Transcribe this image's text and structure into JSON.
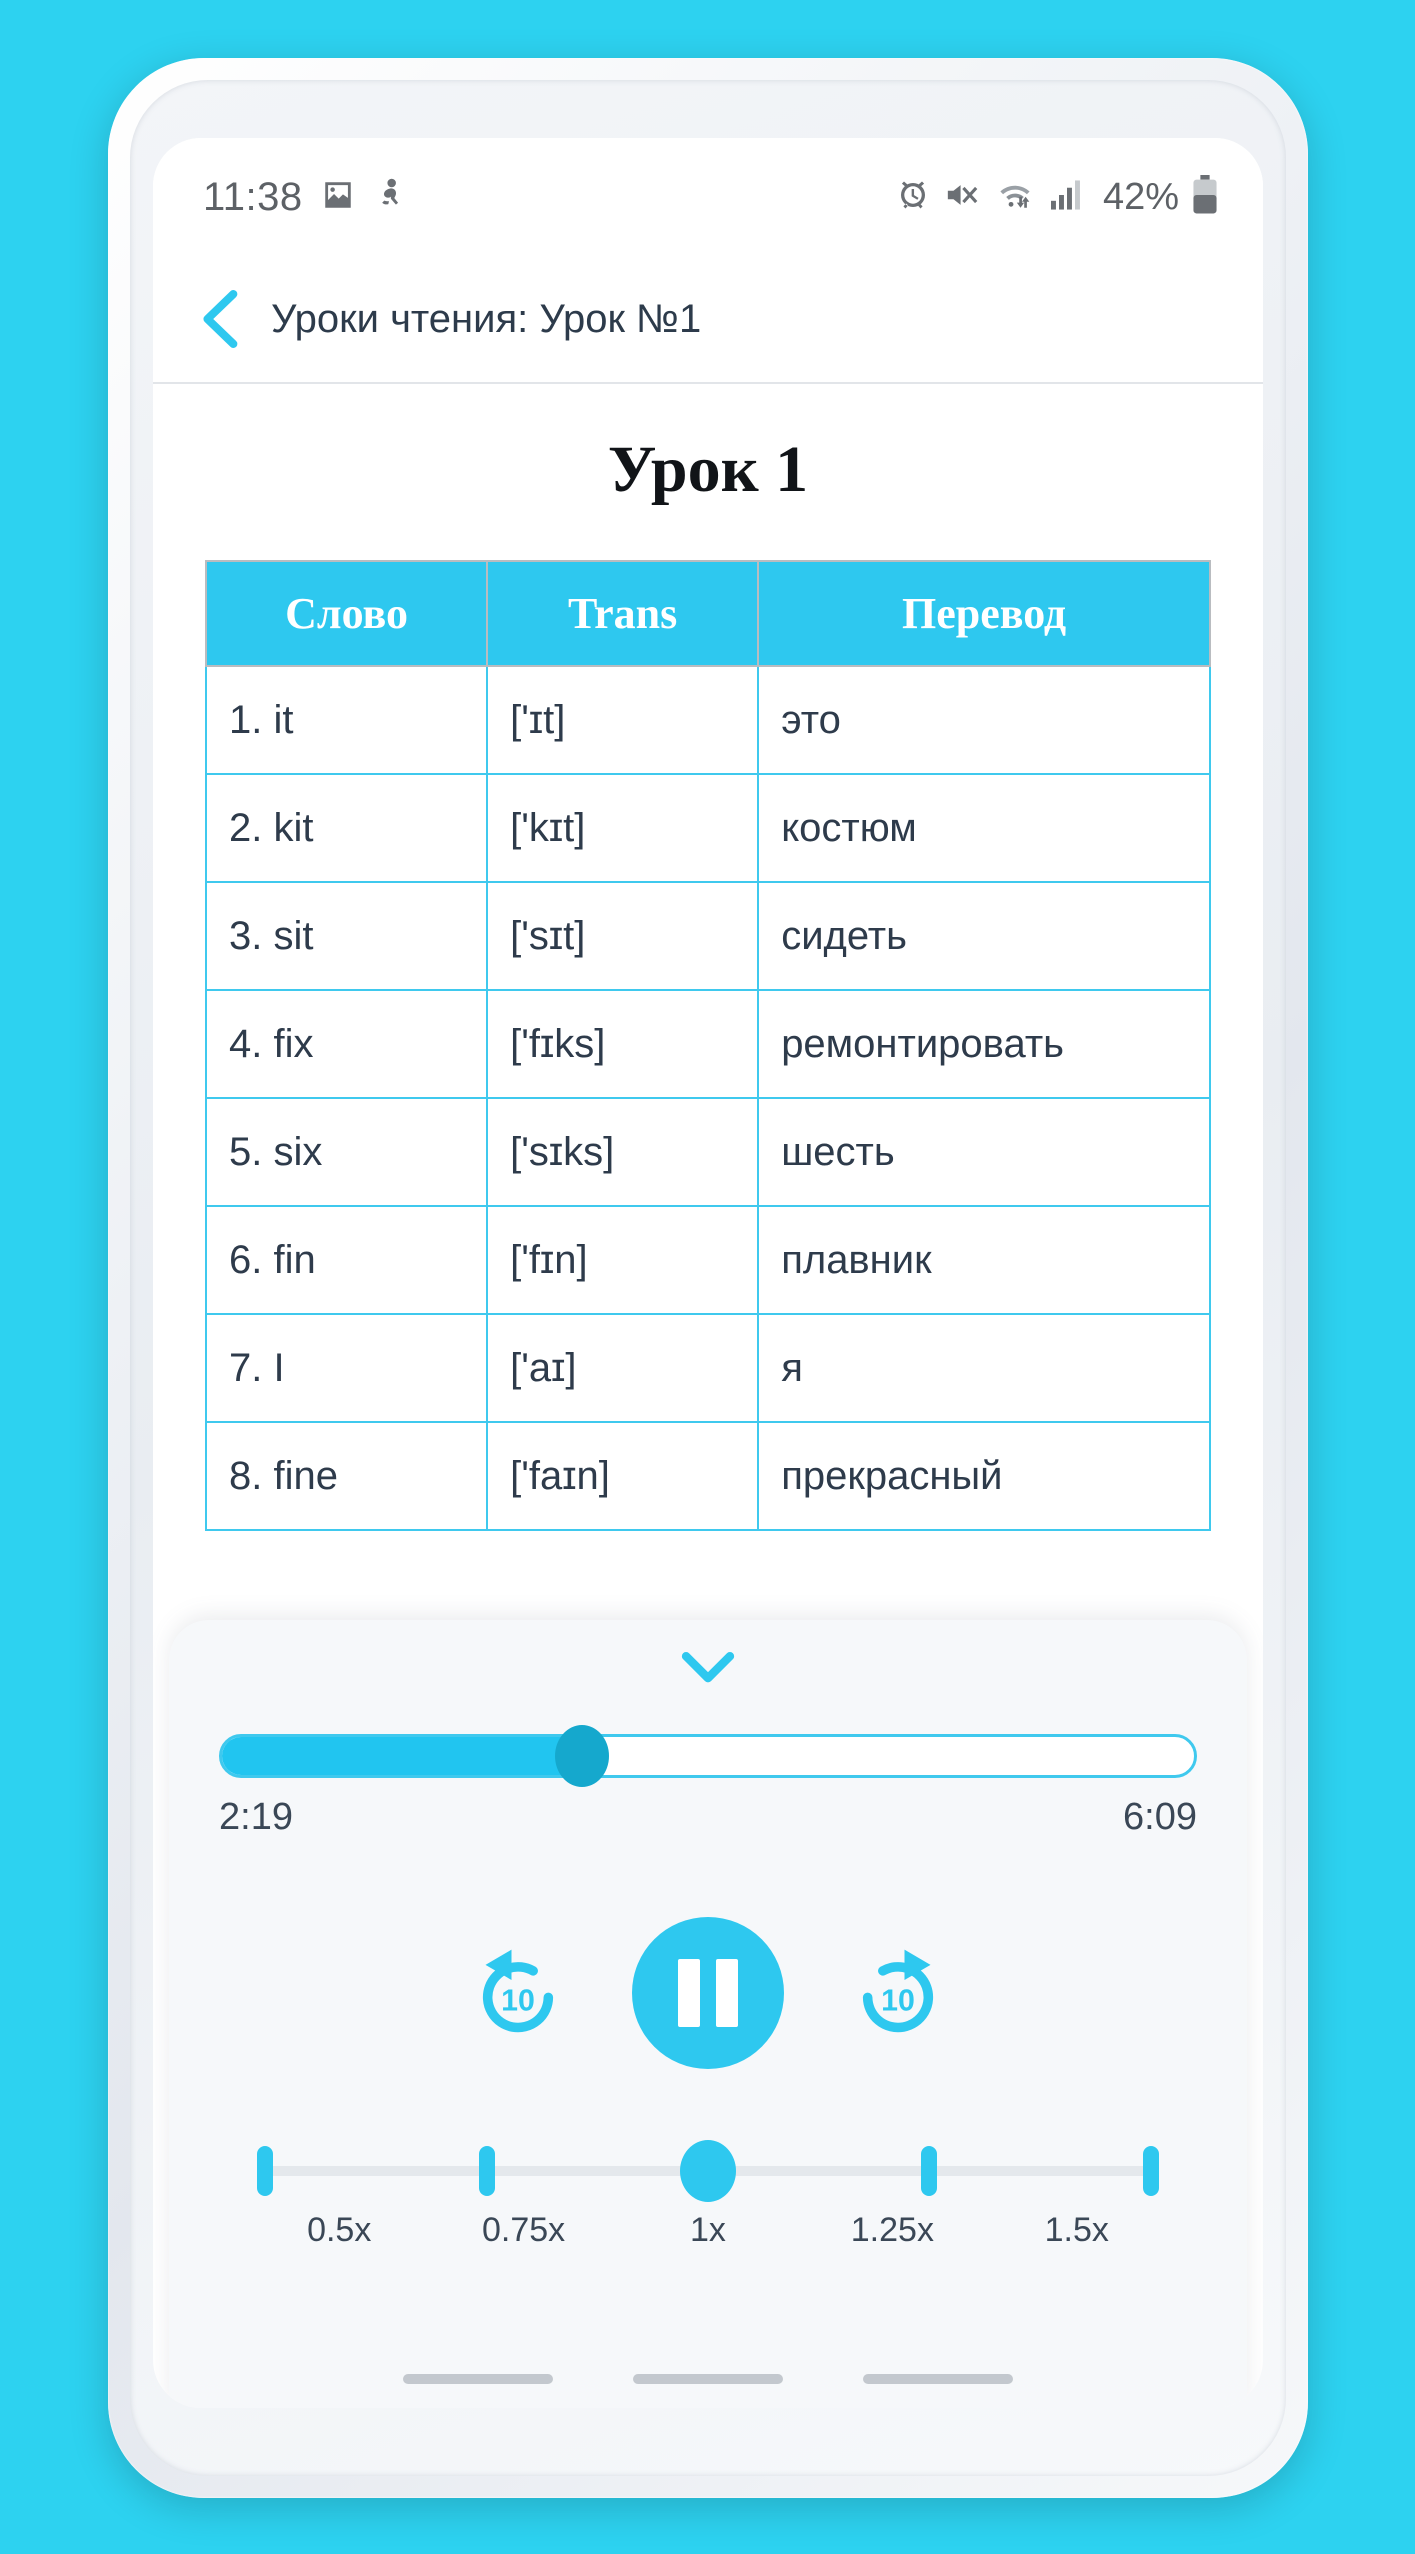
{
  "theme": {
    "accent": "#2ec8ef",
    "accent_dark": "#15a8cd",
    "bg": "#2dd2f0",
    "text": "#2e3b4b"
  },
  "status_bar": {
    "time": "11:38",
    "left_icons": [
      "image-icon",
      "running-person-icon"
    ],
    "right_icons": [
      "alarm-icon",
      "mute-icon",
      "wifi-icon",
      "signal-icon",
      "battery-icon"
    ],
    "battery_percent": "42%"
  },
  "nav": {
    "back_icon": "chevron-left-icon",
    "title": "Уроки чтения: Урок №1"
  },
  "lesson": {
    "heading": "Урок 1"
  },
  "table": {
    "headers": [
      "Слово",
      "Trans",
      "Перевод"
    ],
    "rows": [
      {
        "word": "1. it",
        "trans": "['ɪt]",
        "translation": "это"
      },
      {
        "word": "2. kit",
        "trans": "['kɪt]",
        "translation": "костюм"
      },
      {
        "word": "3. sit",
        "trans": "['sɪt]",
        "translation": "сидеть"
      },
      {
        "word": "4. fix",
        "trans": "['fɪks]",
        "translation": "ремонтировать"
      },
      {
        "word": "5. six",
        "trans": "['sɪks]",
        "translation": "шесть"
      },
      {
        "word": "6. fin",
        "trans": "['fɪn]",
        "translation": "плавник"
      },
      {
        "word": "7. I",
        "trans": "['aɪ]",
        "translation": "я"
      },
      {
        "word": "8. fine",
        "trans": "['faɪn]",
        "translation": "прекрасный"
      }
    ]
  },
  "player": {
    "collapse_icon": "chevron-down-icon",
    "current_time": "2:19",
    "total_time": "6:09",
    "progress_percent": 37,
    "rewind_label": "10",
    "forward_label": "10",
    "rewind_icon": "replay-10-icon",
    "forward_icon": "forward-10-icon",
    "play_state_icon": "pause-icon",
    "speed": {
      "options": [
        "0.5x",
        "0.75x",
        "1x",
        "1.25x",
        "1.5x"
      ],
      "selected": "1x",
      "selected_index": 2
    }
  }
}
